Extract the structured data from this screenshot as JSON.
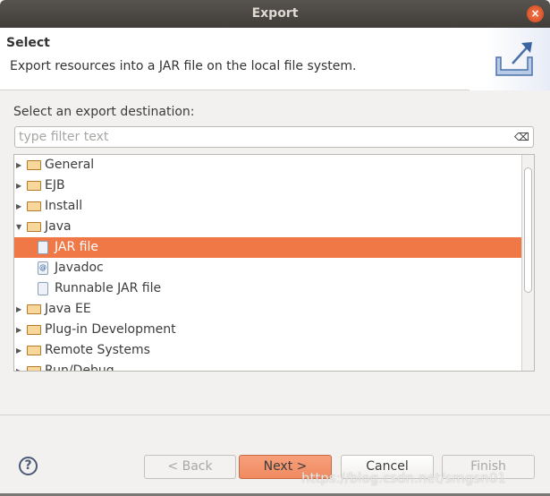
{
  "window": {
    "title": "Export",
    "close_icon": "close-icon"
  },
  "header": {
    "title": "Select",
    "description": "Export resources into a JAR file on the local file system.",
    "banner_icon": "export-icon"
  },
  "label": "Select an export destination:",
  "filter": {
    "placeholder": "type filter text",
    "value": ""
  },
  "tree": [
    {
      "label": "General",
      "type": "folder",
      "expanded": false
    },
    {
      "label": "EJB",
      "type": "folder",
      "expanded": false
    },
    {
      "label": "Install",
      "type": "folder",
      "expanded": false
    },
    {
      "label": "Java",
      "type": "folder",
      "expanded": true
    },
    {
      "label": "JAR file",
      "type": "item",
      "selected": true
    },
    {
      "label": "Javadoc",
      "type": "item"
    },
    {
      "label": "Runnable JAR file",
      "type": "item"
    },
    {
      "label": "Java EE",
      "type": "folder",
      "expanded": false
    },
    {
      "label": "Plug-in Development",
      "type": "folder",
      "expanded": false
    },
    {
      "label": "Remote Systems",
      "type": "folder",
      "expanded": false
    },
    {
      "label": "Run/Debug",
      "type": "folder",
      "expanded": false
    }
  ],
  "buttons": {
    "back": "< Back",
    "next": "Next >",
    "cancel": "Cancel",
    "finish": "Finish"
  },
  "watermark": "https://blog.csdn.net/smgsn01",
  "colors": {
    "selection": "#f07746",
    "titlebar": "#4b4843"
  }
}
